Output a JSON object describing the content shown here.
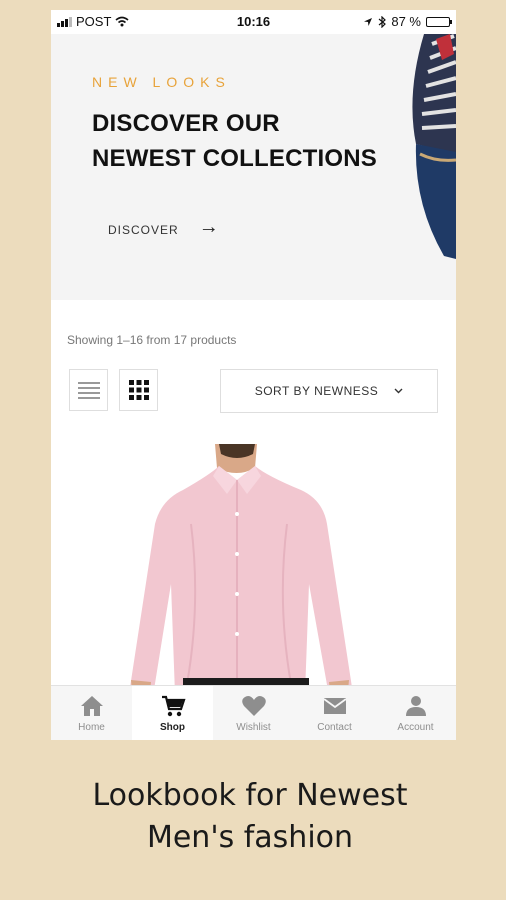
{
  "status_bar": {
    "carrier": "POST",
    "time": "10:16",
    "battery_text": "87 %",
    "battery_level": 0.87
  },
  "hero": {
    "eyebrow": "NEW LOOKS",
    "title_line1": "DISCOVER OUR",
    "title_line2": "NEWEST COLLECTIONS",
    "cta_label": "DISCOVER",
    "cta_icon": "arrow-right-icon"
  },
  "products": {
    "showing_text": "Showing 1–16 from 17 products",
    "sort_label": "SORT BY NEWNESS",
    "view_modes": [
      "list",
      "grid"
    ],
    "active_view": "grid"
  },
  "bottom_nav": {
    "items": [
      {
        "label": "Home",
        "icon": "home-icon",
        "active": false
      },
      {
        "label": "Shop",
        "icon": "cart-icon",
        "active": true
      },
      {
        "label": "Wishlist",
        "icon": "heart-icon",
        "active": false
      },
      {
        "label": "Contact",
        "icon": "mail-icon",
        "active": false
      },
      {
        "label": "Account",
        "icon": "user-icon",
        "active": false
      }
    ]
  },
  "caption": {
    "line1": "Lookbook for Newest",
    "line2": "Men's fashion"
  },
  "colors": {
    "accent": "#e8a33a",
    "background": "#ecdcbd",
    "shirt": "#f2c7d0"
  }
}
